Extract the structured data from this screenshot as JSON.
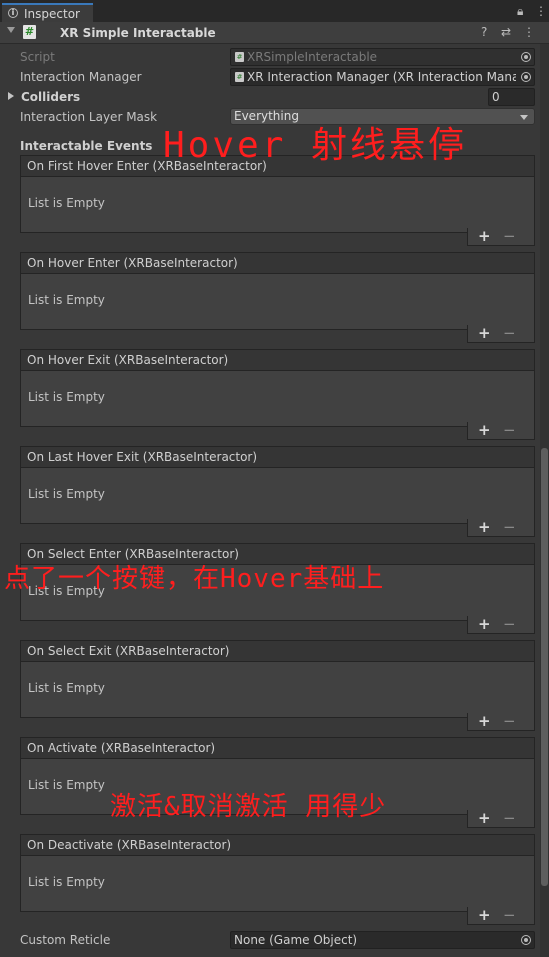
{
  "tab": {
    "label": "Inspector"
  },
  "component": {
    "title": "XR Simple Interactable"
  },
  "properties": {
    "script_label": "Script",
    "script_value": "XRSimpleInteractable",
    "manager_label": "Interaction Manager",
    "manager_value": "XR Interaction Manager (XR Interaction Manager",
    "colliders_label": "Colliders",
    "colliders_count": "0",
    "layer_label": "Interaction Layer Mask",
    "layer_value": "Everything"
  },
  "events_title": "Interactable Events",
  "events": [
    {
      "label": "On First Hover Enter (XRBaseInteractor)",
      "empty": "List is Empty"
    },
    {
      "label": "On Hover Enter (XRBaseInteractor)",
      "empty": "List is Empty"
    },
    {
      "label": "On Hover Exit (XRBaseInteractor)",
      "empty": "List is Empty"
    },
    {
      "label": "On Last Hover Exit (XRBaseInteractor)",
      "empty": "List is Empty"
    },
    {
      "label": "On Select Enter (XRBaseInteractor)",
      "empty": "List is Empty"
    },
    {
      "label": "On Select Exit (XRBaseInteractor)",
      "empty": "List is Empty"
    },
    {
      "label": "On Activate (XRBaseInteractor)",
      "empty": "List is Empty"
    },
    {
      "label": "On Deactivate (XRBaseInteractor)",
      "empty": "List is Empty"
    }
  ],
  "reticle": {
    "label": "Custom Reticle",
    "value": "None (Game Object)"
  },
  "annotations": {
    "hover": "Hover  射线悬停",
    "select": "点了一个按键，在Hover基础上",
    "activate": "激活&取消激活  用得少"
  },
  "icons": {
    "tab": "info-icon",
    "lock": "lock-icon",
    "menu": "kebab-menu-icon",
    "script": "csharp-script-icon",
    "help": "help-icon",
    "presets": "presets-icon"
  },
  "colors": {
    "accent": "#3a79bb",
    "annotation": "#ff1e1e"
  }
}
